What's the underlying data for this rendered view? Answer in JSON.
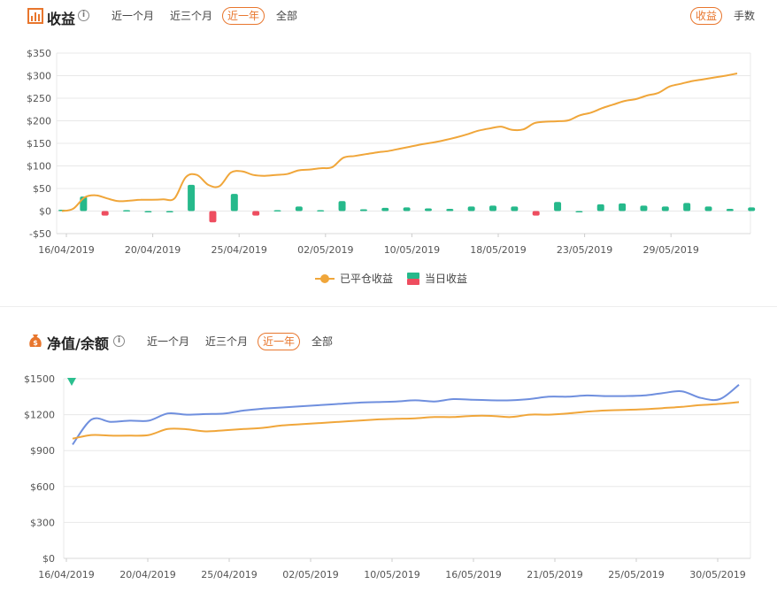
{
  "panel1": {
    "title": "收益",
    "tabs": [
      "近一个月",
      "近三个月",
      "近一年",
      "全部"
    ],
    "active_tab": "近一年",
    "toggle": [
      "收益",
      "手数"
    ],
    "active_toggle": "收益"
  },
  "panel2": {
    "title": "净值/余额",
    "tabs": [
      "近一个月",
      "近三个月",
      "近一年",
      "全部"
    ],
    "active_tab": "近一年"
  },
  "colors": {
    "accent": "#e8762d",
    "orange": "#f0a63a",
    "green": "#26b98b",
    "red": "#ee4d5f",
    "blue": "#6f8fde"
  },
  "chart_data": [
    {
      "type": "line+bar",
      "y_ticks": [
        "$350",
        "$300",
        "$250",
        "$200",
        "$150",
        "$100",
        "$50",
        "$0",
        "-$50"
      ],
      "ylim": [
        -50,
        350
      ],
      "x_ticks": [
        "16/04/2019",
        "20/04/2019",
        "25/04/2019",
        "02/05/2019",
        "10/05/2019",
        "18/05/2019",
        "23/05/2019",
        "29/05/2019"
      ],
      "grid": true,
      "legend_position": "bottom",
      "series": [
        {
          "name": "已平仓收益",
          "kind": "line",
          "color": "#f0a63a",
          "values": [
            0,
            5,
            30,
            35,
            28,
            22,
            23,
            25,
            25,
            26,
            28,
            75,
            80,
            58,
            55,
            85,
            88,
            80,
            78,
            80,
            82,
            90,
            92,
            95,
            97,
            118,
            122,
            126,
            130,
            133,
            138,
            143,
            148,
            152,
            157,
            163,
            170,
            178,
            183,
            187,
            180,
            181,
            195,
            198,
            199,
            201,
            212,
            218,
            228,
            236,
            244,
            248,
            256,
            262,
            276,
            282,
            288,
            292,
            296,
            300,
            305
          ]
        },
        {
          "name": "当日收益",
          "kind": "bar",
          "color_positive": "#26b98b",
          "color_negative": "#ee4d5f",
          "values": [
            3,
            32,
            -10,
            2,
            0,
            0,
            58,
            -25,
            38,
            -10,
            2,
            10,
            2,
            22,
            4,
            7,
            8,
            6,
            5,
            10,
            12,
            10,
            -10,
            20,
            0,
            15,
            17,
            12,
            10,
            18,
            10,
            5,
            8
          ]
        }
      ]
    },
    {
      "type": "line",
      "y_ticks": [
        "$1500",
        "$1200",
        "$900",
        "$600",
        "$300",
        "$0"
      ],
      "ylim": [
        0,
        1500
      ],
      "x_ticks": [
        "16/04/2019",
        "20/04/2019",
        "25/04/2019",
        "02/05/2019",
        "10/05/2019",
        "16/05/2019",
        "21/05/2019",
        "25/05/2019",
        "30/05/2019"
      ],
      "grid": true,
      "series": [
        {
          "name": "",
          "kind": "line",
          "color": "#6f8fde",
          "values": [
            950,
            1160,
            1140,
            1150,
            1150,
            1210,
            1200,
            1205,
            1210,
            1235,
            1250,
            1260,
            1270,
            1280,
            1290,
            1300,
            1305,
            1310,
            1320,
            1310,
            1330,
            1325,
            1320,
            1320,
            1330,
            1350,
            1350,
            1360,
            1355,
            1355,
            1360,
            1380,
            1395,
            1340,
            1330,
            1450
          ]
        },
        {
          "name": "",
          "kind": "line",
          "color": "#f0a63a",
          "values": [
            1000,
            1030,
            1025,
            1025,
            1030,
            1080,
            1078,
            1060,
            1070,
            1080,
            1090,
            1110,
            1120,
            1130,
            1140,
            1150,
            1160,
            1165,
            1170,
            1180,
            1180,
            1190,
            1190,
            1180,
            1200,
            1200,
            1210,
            1225,
            1235,
            1240,
            1245,
            1255,
            1265,
            1280,
            1290,
            1305
          ]
        }
      ]
    }
  ]
}
